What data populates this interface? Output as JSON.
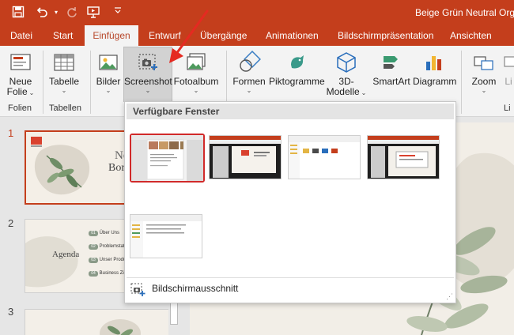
{
  "titlebar": {
    "doc_title": "Beige Grün Neutral Orga"
  },
  "tabs": [
    "Datei",
    "Start",
    "Einfügen",
    "Entwurf",
    "Übergänge",
    "Animationen",
    "Bildschirmpräsentation",
    "Ansichten"
  ],
  "active_tab": "Einfügen",
  "ribbon": {
    "neue_folie": [
      "Neue",
      "Folie"
    ],
    "tabelle": "Tabelle",
    "bilder": "Bilder",
    "screenshot": "Screenshot",
    "fotoalbum": "Fotoalbum",
    "formen": "Formen",
    "piktogramme": "Piktogramme",
    "modelle": [
      "3D-",
      "Modelle"
    ],
    "smartart": "SmartArt",
    "diagramm": "Diagramm",
    "zoom": "Zoom",
    "li": "Li",
    "groups": {
      "folien": "Folien",
      "tabellen": "Tabellen",
      "li": "Li"
    }
  },
  "dropdown": {
    "header": "Verfügbare Fenster",
    "clip_label": "Bildschirmausschnitt",
    "clip_accel": "B"
  },
  "slides": {
    "numbers": [
      "1",
      "2",
      "3"
    ],
    "slide1": {
      "title_frag": "Neu",
      "sub_frag": "Bor"
    },
    "slide2": {
      "heading": "Agenda",
      "items": [
        {
          "num": "01",
          "text": "Über Uns"
        },
        {
          "num": "02",
          "text": "Problemstatu"
        },
        {
          "num": "03",
          "text": "Unser Produk"
        },
        {
          "num": "04",
          "text": "Business Zie"
        }
      ]
    }
  },
  "colors": {
    "accent": "#c43e1c",
    "ribbon_bg": "#f3f3f3",
    "selection": "#d12a2a"
  }
}
